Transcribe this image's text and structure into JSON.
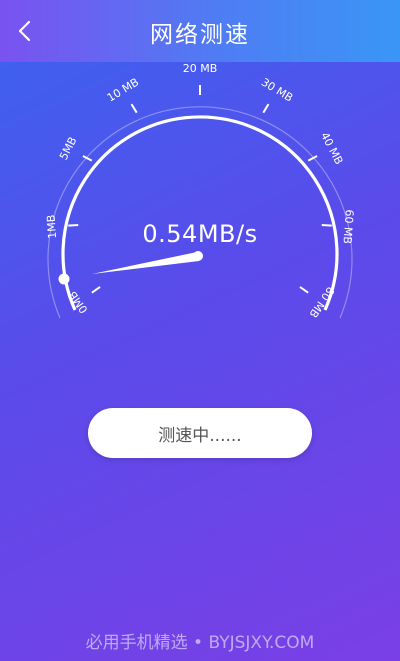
{
  "header": {
    "title": "网络测速",
    "back_icon": "chevron-left-icon"
  },
  "gauge": {
    "speed_text": "0.54MB/s",
    "speed_value_mb": 0.54,
    "max_label": "80 MB",
    "tick_labels": [
      "0MB",
      "1MB",
      "5MB",
      "10 MB",
      "20 MB",
      "30 MB",
      "40 MB",
      "60 MB",
      "80 MB"
    ],
    "progress_fraction": 0.05
  },
  "button": {
    "status_label": "测速中......"
  },
  "watermark": "必用手机精选 • BYJSJXY.COM",
  "colors": {
    "header_start": "#7a52f0",
    "header_end": "#3a96f6",
    "background_start": "#3a64f0",
    "background_end": "#7a3fe6"
  }
}
